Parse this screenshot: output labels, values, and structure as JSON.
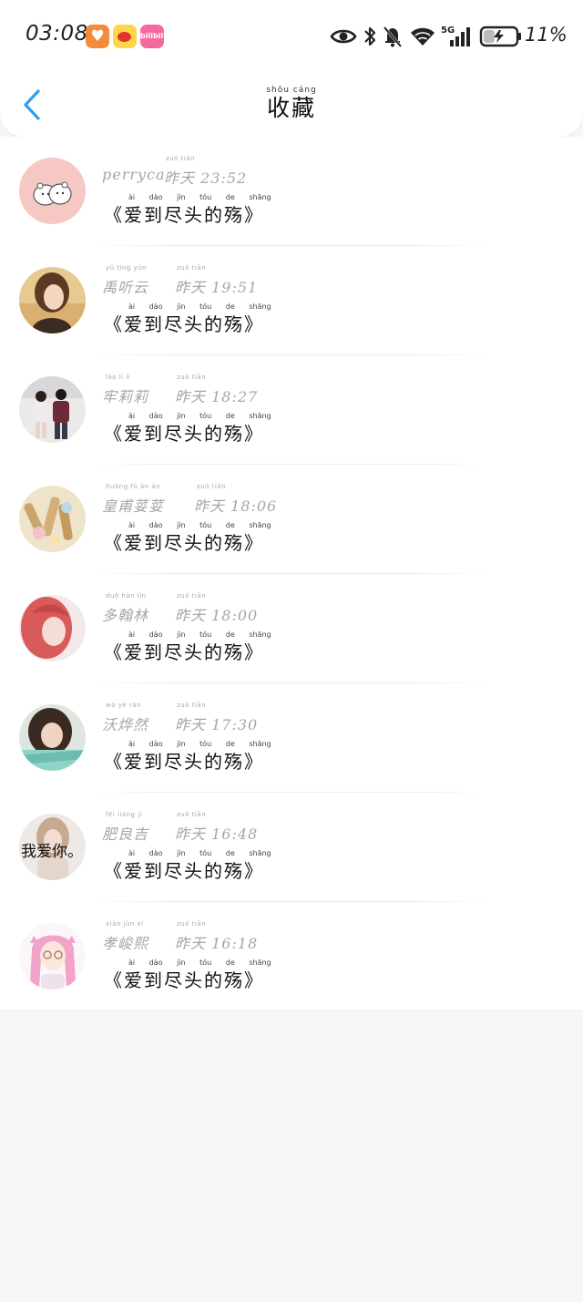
{
  "status_bar": {
    "time": "03:08",
    "battery_percent": "11%",
    "battery_level": 0.11,
    "network": "5G",
    "bili_label": "bilibili"
  },
  "header": {
    "title_pinyin": "shōu cáng",
    "title": "收藏"
  },
  "song": {
    "pinyin": "ài dào jìn tóu de shāng",
    "title": "《爱到尽头的殇》"
  },
  "yesterday_pinyin": "zuó tiān",
  "items": [
    {
      "name": "perryca",
      "name_pinyin": "",
      "stamp": "昨天 23:52"
    },
    {
      "name": "禹听云",
      "name_pinyin": "yǔ tīng yún",
      "stamp": "昨天 19:51"
    },
    {
      "name": "牢莉莉",
      "name_pinyin": "láo lì lì",
      "stamp": "昨天 18:27"
    },
    {
      "name": "皇甫荽荽",
      "name_pinyin": "huáng fǔ ān ān",
      "stamp": "昨天 18:06"
    },
    {
      "name": "多翰林",
      "name_pinyin": "duō hàn lín",
      "stamp": "昨天 18:00"
    },
    {
      "name": "沃烨然",
      "name_pinyin": "wò yè rán",
      "stamp": "昨天 17:30"
    },
    {
      "name": "肥良吉",
      "name_pinyin": "féi liáng jí",
      "stamp": "昨天 16:48",
      "avatar_text": "我爱你。"
    },
    {
      "name": "孝峻熙",
      "name_pinyin": "xiào jùn xī",
      "stamp": "昨天 16:18"
    }
  ],
  "colors": {
    "accent": "#2d9ef0",
    "name_gray": "#a6a6a6",
    "background": "#f7f6f6"
  }
}
